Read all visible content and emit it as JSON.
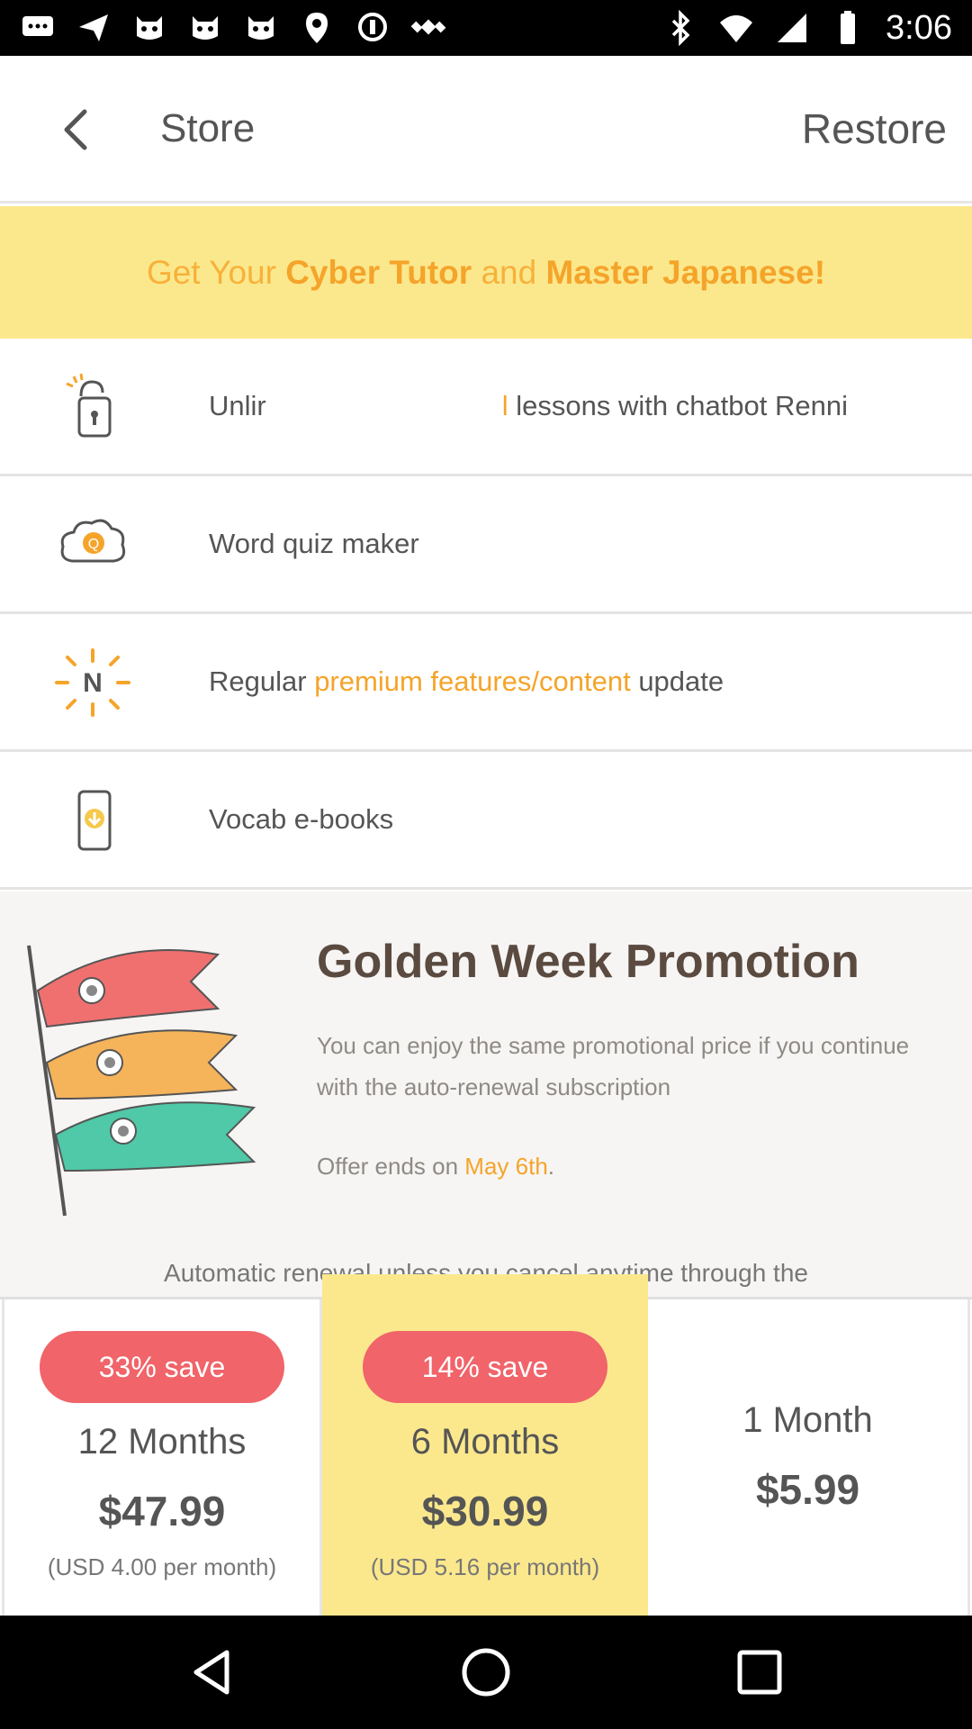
{
  "status_bar": {
    "time": "3:06",
    "left_icons": [
      "chat-icon",
      "send-icon",
      "cat-icon",
      "cat-icon",
      "cat-icon",
      "fake-gps-icon",
      "data-saver-icon",
      "satellite-icon"
    ],
    "right_icons": [
      "bluetooth-icon",
      "wifi-icon",
      "signal-icon",
      "battery-icon"
    ]
  },
  "header": {
    "title": "Store",
    "restore_label": "Restore"
  },
  "banner": {
    "prefix": "Get Your ",
    "highlight1": "Cyber Tutor",
    "middle": " and ",
    "highlight2": "Master Japanese!"
  },
  "features": [
    {
      "icon": "unlock-icon",
      "text_a": "Unlir",
      "text_hl": "l",
      "text_b": " lessons with chatbot Renni"
    },
    {
      "icon": "quiz-cloud-icon",
      "text": "Word quiz maker"
    },
    {
      "icon": "new-sun-icon",
      "text_a": "Regular ",
      "text_hl": "premium features/content",
      "text_b": " update"
    },
    {
      "icon": "ebook-download-icon",
      "text": "Vocab e-books"
    }
  ],
  "promotion": {
    "title": "Golden Week Promotion",
    "description": "You can enjoy the same promotional price if you continue with the auto-renewal subscription",
    "offer_prefix": "Offer ends on ",
    "offer_date": "May 6th",
    "offer_suffix": ".",
    "subtext": "Automatic renewal unless you cancel anytime through the"
  },
  "plans": [
    {
      "badge": "33% save",
      "name": "12 Months",
      "price": "$47.99",
      "note": "(USD 4.00 per month)"
    },
    {
      "badge": "14% save",
      "name": "6 Months",
      "price": "$30.99",
      "note": "(USD 5.16 per month)"
    },
    {
      "name": "1 Month",
      "price": "$5.99"
    }
  ],
  "colors": {
    "accent_yellow": "#fbe88d",
    "accent_orange": "#f5a42a",
    "badge_red": "#f0646a"
  }
}
